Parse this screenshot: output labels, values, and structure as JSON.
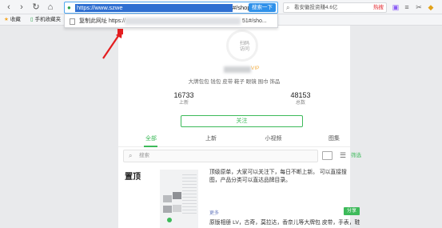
{
  "browser": {
    "url_selected": "https://www.szwe",
    "url_tail": "#/shop.",
    "go_button": "搜索一下",
    "search_text": "看安徽投资赚4.6亿",
    "search_hot": "热搜",
    "bookmarks": [
      {
        "label": "收藏",
        "icon": "star-icon"
      },
      {
        "label": "手机收藏夹",
        "icon": "phone-icon"
      }
    ],
    "dropdown": {
      "label": "复制此网址 https://",
      "tail": "51#/sho..."
    }
  },
  "shop": {
    "avatar_text": "扫码 访问",
    "badge": "VIP",
    "tags": "大牌包包  钱包  皮带  鞋子  眼镜  围巾  饰品",
    "stats": [
      {
        "value": "16733",
        "label": "上新"
      },
      {
        "value": "48153",
        "label": "总数"
      }
    ],
    "follow_label": "关注",
    "tabs": [
      {
        "label": "全部",
        "active": true
      },
      {
        "label": "上新",
        "active": false
      },
      {
        "label": "小视频",
        "active": false
      },
      {
        "label": "图集",
        "active": false
      }
    ],
    "search_placeholder": "搜索",
    "filter_label": "筛选",
    "section_title": "置顶",
    "post_text": "顶级原单，大家可以关注下，每日不断上新。 可以直接搜图，产品分类可以直达品牌目录。",
    "post_link": "更多",
    "share_label": "分享",
    "post2_text": "原版相册 LV，古奇，莫拉达，香奈儿等大牌包 皮带，手表，鞋"
  },
  "colors": {
    "accent_green": "#3dba5a",
    "url_highlight": "#2f6fd1",
    "annotation_red": "#e41e20"
  }
}
